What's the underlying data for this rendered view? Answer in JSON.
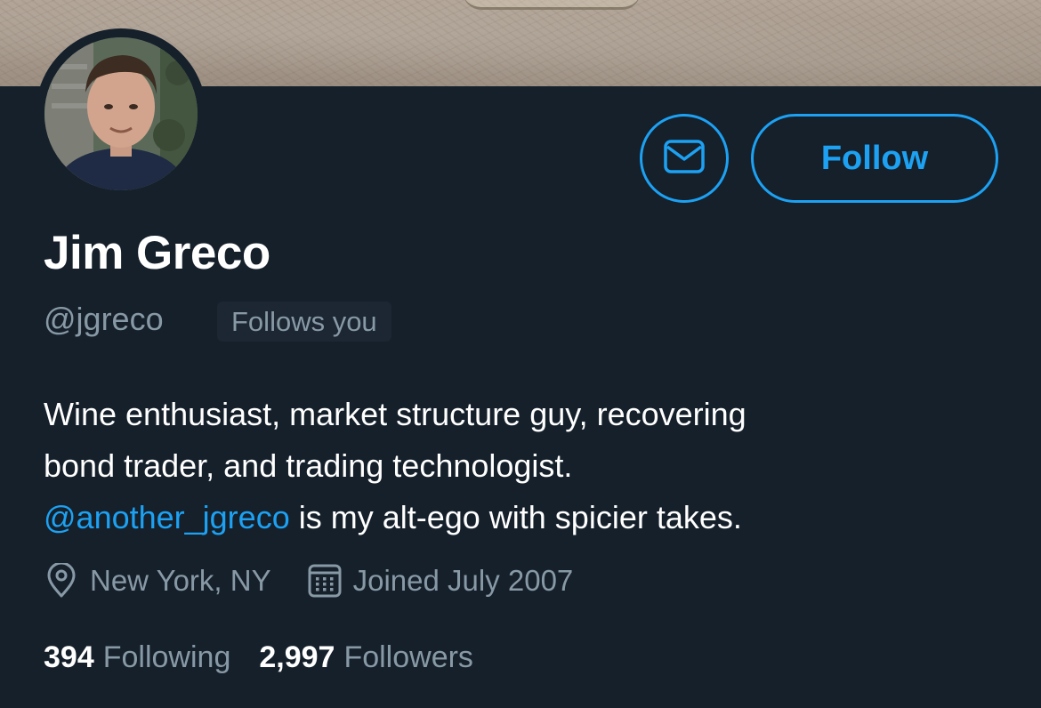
{
  "profile": {
    "name": "Jim Greco",
    "handle": "@jgreco",
    "follows_you_badge": "Follows you",
    "follow_button_label": "Follow",
    "message_icon": "envelope-icon"
  },
  "bio": {
    "line1": "Wine enthusiast, market structure guy, recovering",
    "line2": "bond trader, and trading technologist.",
    "mention": "@another_jgreco",
    "line3_rest": " is my alt-ego with spicier takes."
  },
  "meta": {
    "location": "New York, NY",
    "location_icon": "location-pin-icon",
    "joined": "Joined July 2007",
    "joined_icon": "calendar-icon"
  },
  "stats": {
    "following_count": "394",
    "following_label": "Following",
    "followers_count": "2,997",
    "followers_label": "Followers"
  },
  "colors": {
    "background": "#15202b",
    "accent": "#1da1f2",
    "secondary_text": "#8899a6",
    "primary_text": "#ffffff",
    "badge_background": "#1c2733"
  }
}
